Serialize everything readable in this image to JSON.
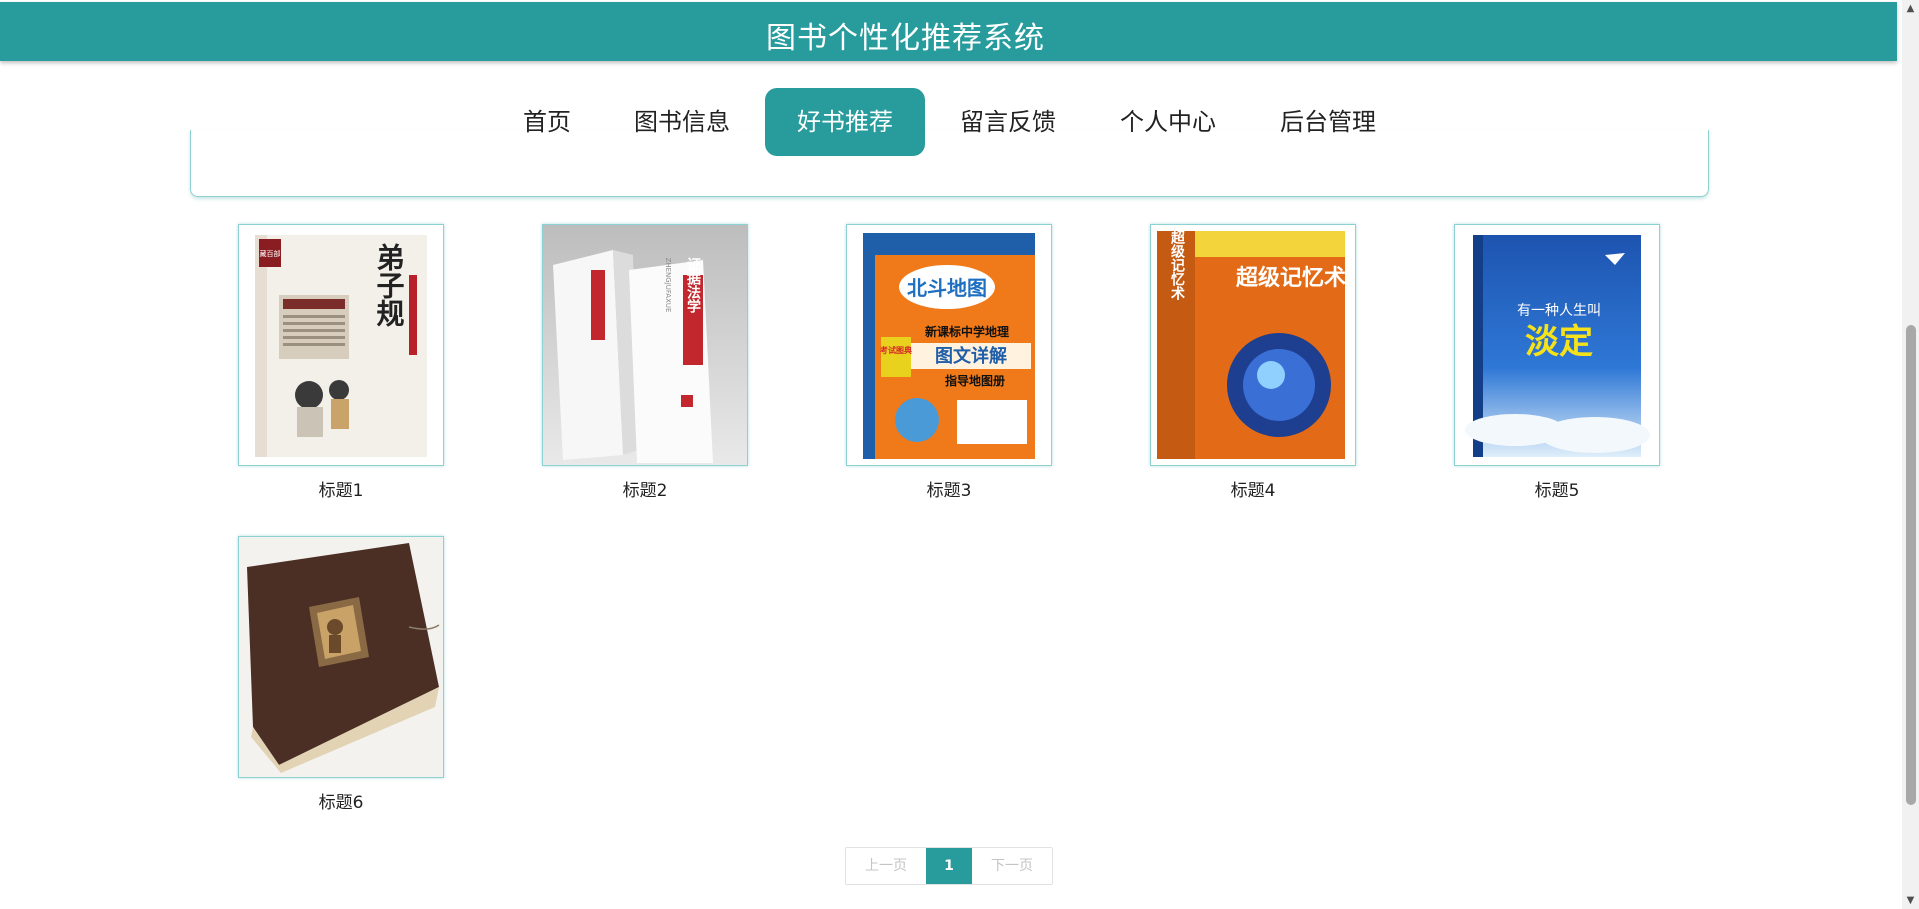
{
  "header": {
    "title": "图书个性化推荐系统"
  },
  "nav": {
    "items": [
      {
        "label": "首页"
      },
      {
        "label": "图书信息"
      },
      {
        "label": "好书推荐",
        "active": true
      },
      {
        "label": "留言反馈"
      },
      {
        "label": "个人中心"
      },
      {
        "label": "后台管理"
      }
    ]
  },
  "books": [
    {
      "title": "标题1",
      "cover_text": "弟子规",
      "cover_corner": "藏百部"
    },
    {
      "title": "标题2",
      "cover_text": "证据法学",
      "cover_sub": "ZHENGJUFAXUE"
    },
    {
      "title": "标题3",
      "cover_brand": "北斗地图",
      "cover_line1": "新课标中学地理",
      "cover_line2": "图文详解",
      "cover_line3": "指导地图册",
      "cover_badge": "考试图典"
    },
    {
      "title": "标题4",
      "cover_text": "超级记忆术",
      "cover_spine": "超级记忆术"
    },
    {
      "title": "标题5",
      "cover_line1": "有一种人生叫",
      "cover_text": "淡定"
    },
    {
      "title": "标题6"
    }
  ],
  "pagination": {
    "prev_label": "上一页",
    "current": "1",
    "next_label": "下一页"
  },
  "colors": {
    "brand": "#289c9d",
    "border_accent": "#8ed1d1"
  }
}
